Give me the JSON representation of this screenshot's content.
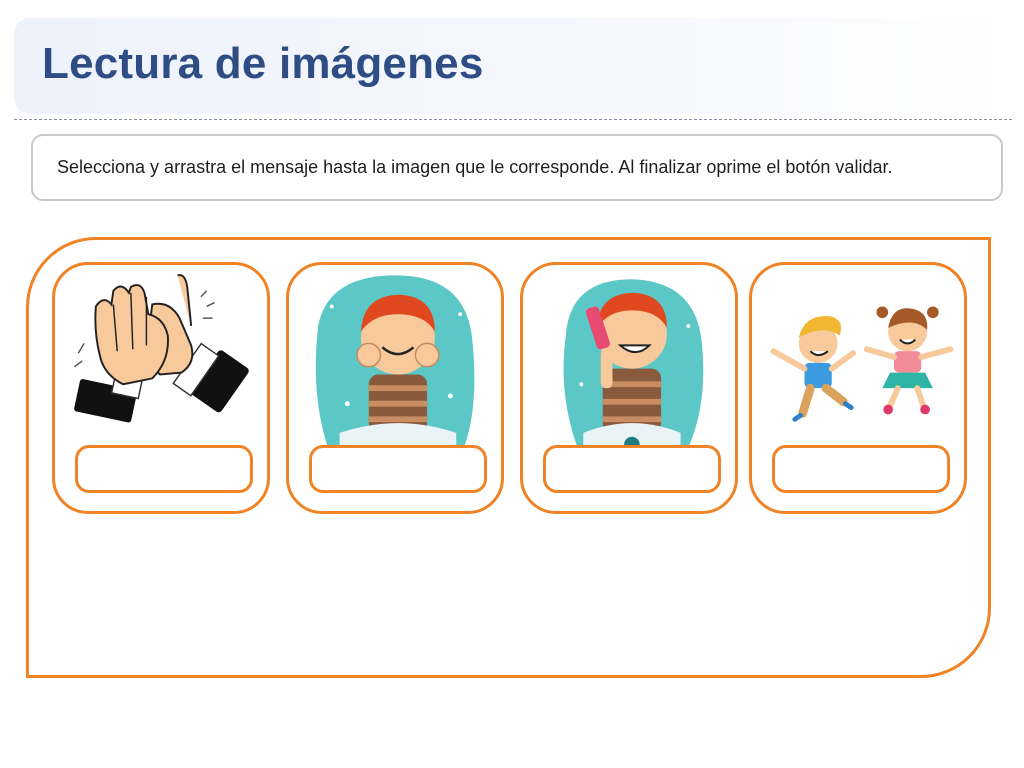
{
  "header": {
    "title": "Lectura de imágenes"
  },
  "instructions": {
    "text": "Selecciona y arrastra el mensaje hasta la imagen que le corresponde. Al finalizar oprime el botón validar."
  },
  "cards": [
    {
      "icon": "clapping-hands-icon",
      "slot_text": ""
    },
    {
      "icon": "boy-washing-face-icon",
      "slot_text": ""
    },
    {
      "icon": "boy-brushing-hair-icon",
      "slot_text": ""
    },
    {
      "icon": "children-jumping-icon",
      "slot_text": ""
    }
  ],
  "colors": {
    "accent": "#ef8325",
    "title": "#2e4d84",
    "border": "#c9c9c9"
  }
}
